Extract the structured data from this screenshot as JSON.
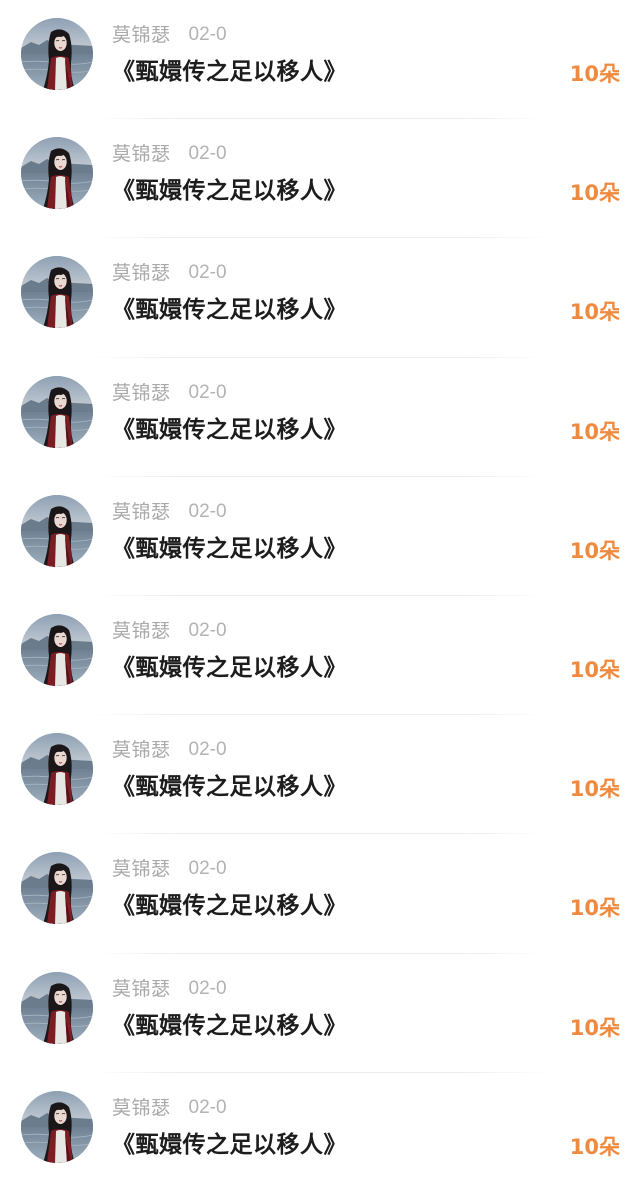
{
  "records": [
    {
      "user": "莫锦瑟",
      "date": "02-0",
      "title": "《甄嬛传之足以移人》",
      "gift": "10朵",
      "avatar": "user-avatar-photo"
    },
    {
      "user": "莫锦瑟",
      "date": "02-0",
      "title": "《甄嬛传之足以移人》",
      "gift": "10朵",
      "avatar": "user-avatar-photo"
    },
    {
      "user": "莫锦瑟",
      "date": "02-0",
      "title": "《甄嬛传之足以移人》",
      "gift": "10朵",
      "avatar": "user-avatar-photo"
    },
    {
      "user": "莫锦瑟",
      "date": "02-0",
      "title": "《甄嬛传之足以移人》",
      "gift": "10朵",
      "avatar": "user-avatar-photo"
    },
    {
      "user": "莫锦瑟",
      "date": "02-0",
      "title": "《甄嬛传之足以移人》",
      "gift": "10朵",
      "avatar": "user-avatar-photo"
    },
    {
      "user": "莫锦瑟",
      "date": "02-0",
      "title": "《甄嬛传之足以移人》",
      "gift": "10朵",
      "avatar": "user-avatar-photo"
    },
    {
      "user": "莫锦瑟",
      "date": "02-0",
      "title": "《甄嬛传之足以移人》",
      "gift": "10朵",
      "avatar": "user-avatar-photo"
    },
    {
      "user": "莫锦瑟",
      "date": "02-0",
      "title": "《甄嬛传之足以移人》",
      "gift": "10朵",
      "avatar": "user-avatar-photo"
    },
    {
      "user": "莫锦瑟",
      "date": "02-0",
      "title": "《甄嬛传之足以移人》",
      "gift": "10朵",
      "avatar": "user-avatar-photo"
    },
    {
      "user": "莫锦瑟",
      "date": "02-0",
      "title": "《甄嬛传之足以移人》",
      "gift": "10朵",
      "avatar": "user-avatar-photo"
    }
  ],
  "colors": {
    "gift_accent": "#f08a3e",
    "meta_text": "#a9a9a9",
    "title_text": "#1d1d1d"
  }
}
